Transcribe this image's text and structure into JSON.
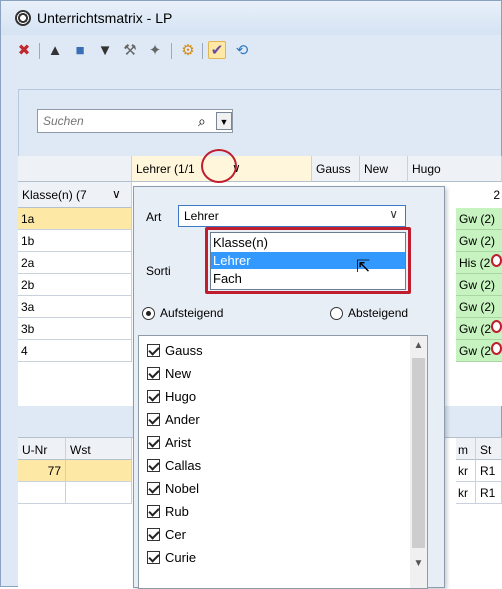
{
  "window": {
    "title": "Unterrichtsmatrix - LP"
  },
  "toolbar": {
    "icons": [
      "delete-icon",
      "graduation-cap-icon",
      "book-icon",
      "teacher-hat-icon",
      "wrench-icon",
      "wand-icon",
      "gear-icon",
      "checklist-icon",
      "refresh-icon"
    ],
    "glyphs": {
      "delete": "✖",
      "cap": "🎓",
      "book": "📘",
      "hat": "🎩",
      "wrench": "🔧",
      "wand": "✨",
      "gear": "⚙",
      "check": "✔",
      "refresh": "⟲"
    }
  },
  "search": {
    "placeholder": "Suchen",
    "icon_glyph": "⌕",
    "dropdown_glyph": "▼"
  },
  "grid": {
    "top_header": [
      "Lehrer (1",
      "/1",
      "Gauss",
      "New",
      "Hugo"
    ],
    "dropdown_glyph": "∨",
    "row_header_label": "Klasse(n) (7",
    "rows": [
      "1a",
      "1b",
      "2a",
      "2b",
      "3a",
      "3b",
      "4"
    ],
    "hugo_count": "2",
    "hugo_cells": [
      "Gw (2)",
      "Gw (2)",
      "His (2",
      "Gw (2)",
      "Gw (2)",
      "Gw (2",
      "Gw (2"
    ]
  },
  "popup": {
    "art_label": "Art",
    "art_value": "Lehrer",
    "chevron": "∨",
    "sort_label": "Sorti",
    "options": [
      "Klasse(n)",
      "Lehrer",
      "Fach"
    ],
    "selected_option": "Lehrer",
    "radio_asc": "Aufsteigend",
    "radio_desc": "Absteigend",
    "items": [
      "Gauss",
      "New",
      "Hugo",
      "Ander",
      "Arist",
      "Callas",
      "Nobel",
      "Rub",
      "Cer",
      "Curie"
    ],
    "scroll_up": "▲",
    "scroll_down": "▼"
  },
  "bottom": {
    "headers": [
      "U-Nr",
      "Wst",
      "m",
      "St"
    ],
    "rows": [
      {
        "unr": "77",
        "m": "kr",
        "st": "R1"
      },
      {
        "unr": "",
        "m": "kr",
        "st": "R1"
      }
    ]
  },
  "colors": {
    "accent_red": "#c01d2e",
    "highlight": "#fde8a6",
    "green": "#c6f3bf",
    "select_blue": "#3399ff"
  }
}
